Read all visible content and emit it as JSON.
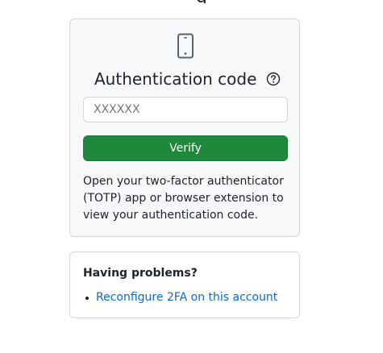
{
  "page": {
    "title_fragment": "g"
  },
  "auth_card": {
    "icon": "device-mobile-icon",
    "title": "Authentication code",
    "help_icon": "question-circle-icon",
    "code_input": {
      "placeholder": "XXXXXX",
      "value": ""
    },
    "verify_label": "Verify",
    "instructions": "Open your two-factor authenticator (TOTP) app or browser extension to view your authentication code."
  },
  "problems_card": {
    "title": "Having problems?",
    "links": [
      {
        "label": "Reconfigure 2FA on this account"
      }
    ]
  },
  "colors": {
    "primary_button": "#1f883d",
    "link": "#0969da",
    "card_background": "#f6f8fa",
    "border": "#d0d7de",
    "text": "#1f2328"
  }
}
